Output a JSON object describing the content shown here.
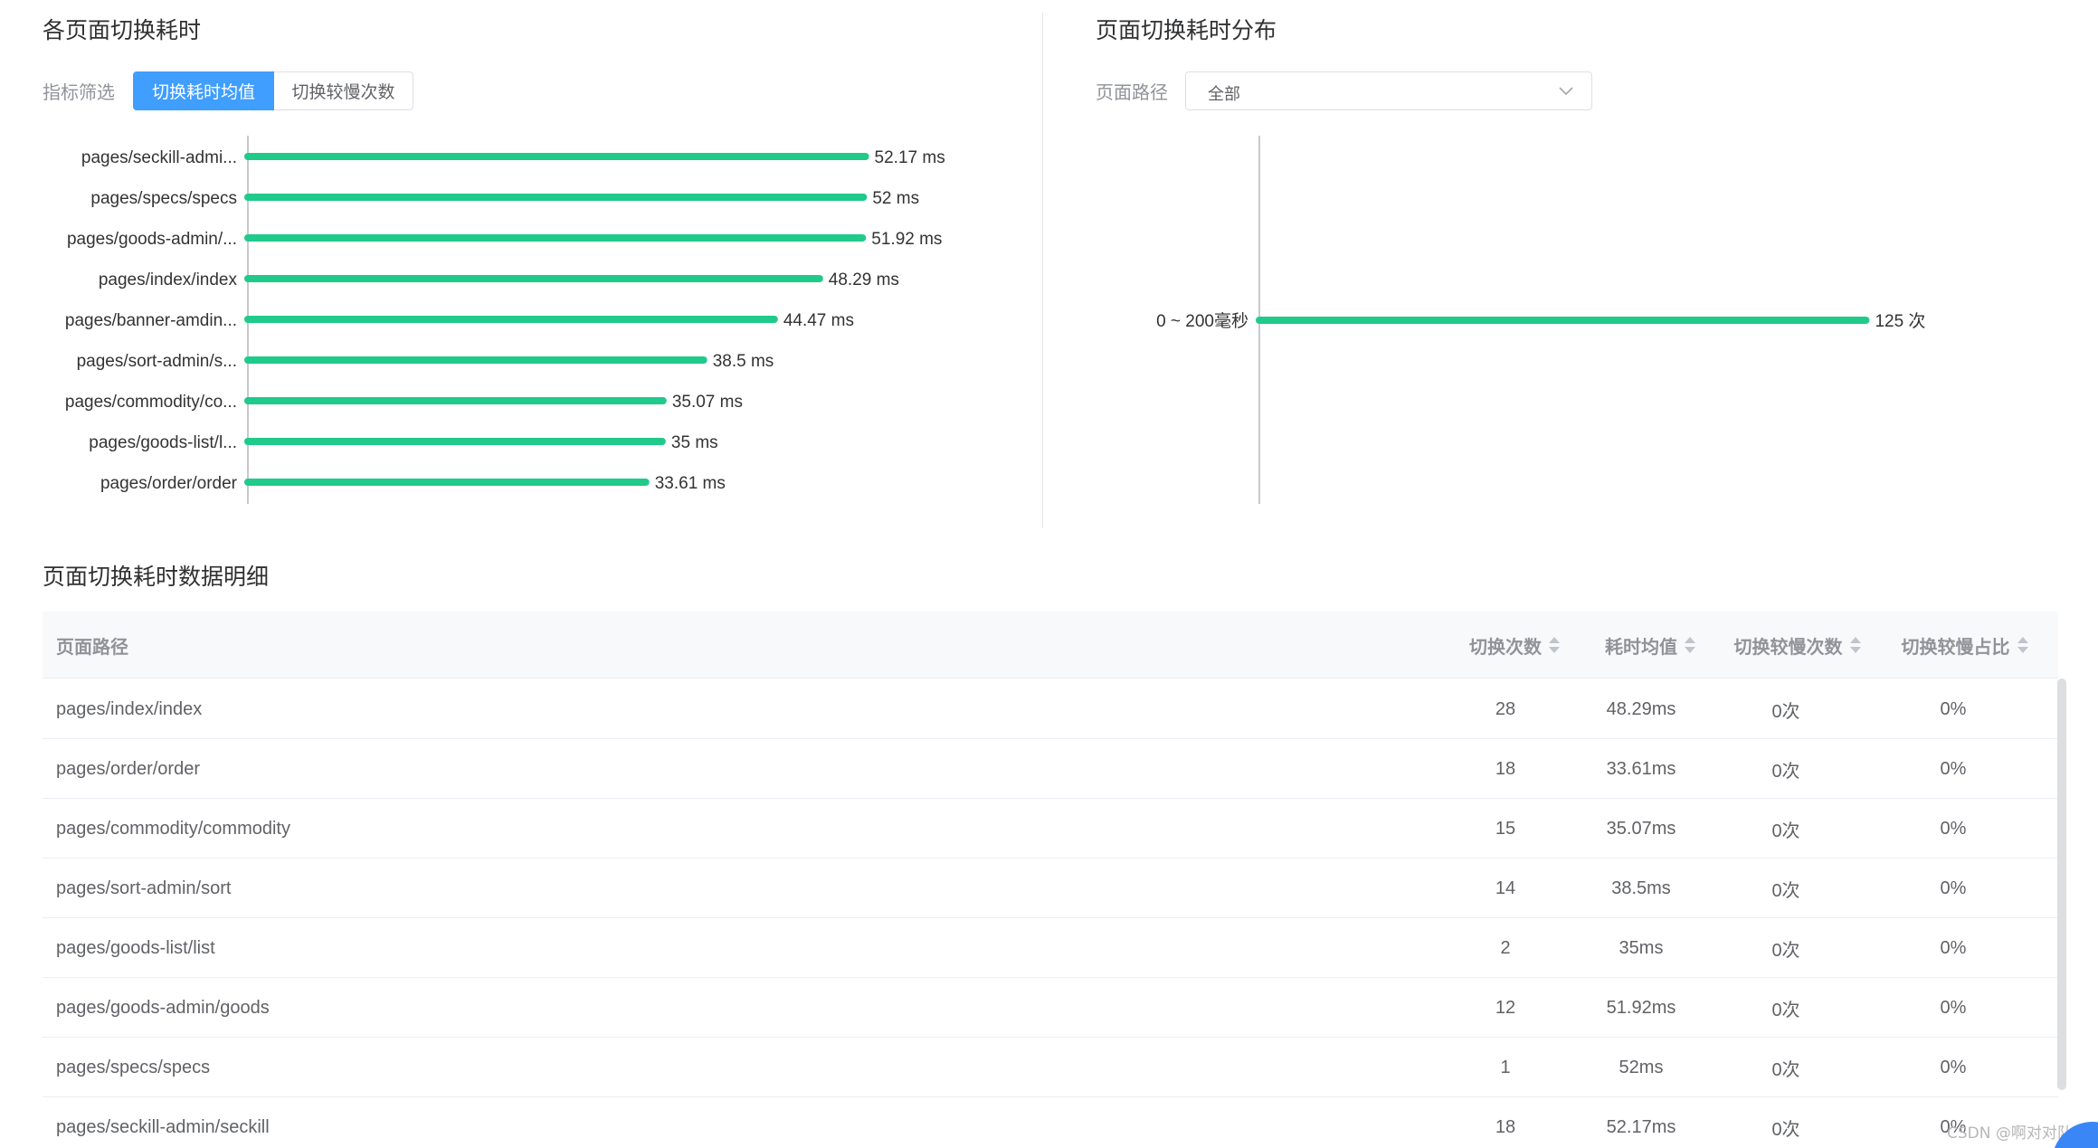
{
  "left_panel": {
    "title": "各页面切换耗时",
    "filter_label": "指标筛选",
    "tabs": [
      "切换耗时均值",
      "切换较慢次数"
    ],
    "active_tab": "切换耗时均值"
  },
  "right_panel": {
    "title": "页面切换耗时分布",
    "path_label": "页面路径",
    "select_value": "全部"
  },
  "colors": {
    "bar": "#1fca8a",
    "accent": "#409eff"
  },
  "chart_data": [
    {
      "type": "bar",
      "orientation": "horizontal",
      "categories": [
        "pages/seckill-admi...",
        "pages/specs/specs",
        "pages/goods-admin/...",
        "pages/index/index",
        "pages/banner-amdin...",
        "pages/sort-admin/s...",
        "pages/commodity/co...",
        "pages/goods-list/l...",
        "pages/order/order"
      ],
      "values": [
        52.17,
        52,
        51.92,
        48.29,
        44.47,
        38.5,
        35.07,
        35,
        33.61
      ],
      "labels": [
        "52.17 ms",
        "52 ms",
        "51.92 ms",
        "48.29 ms",
        "44.47 ms",
        "38.5 ms",
        "35.07 ms",
        "35 ms",
        "33.61 ms"
      ],
      "xlim": [
        0,
        60
      ]
    },
    {
      "type": "bar",
      "orientation": "horizontal",
      "categories": [
        "0 ~ 200毫秒"
      ],
      "values": [
        125
      ],
      "labels": [
        "125 次"
      ],
      "xlim": [
        0,
        165
      ]
    }
  ],
  "table": {
    "title": "页面切换耗时数据明细",
    "headers": [
      "页面路径",
      "切换次数",
      "耗时均值",
      "切换较慢次数",
      "切换较慢占比"
    ],
    "rows": [
      [
        "pages/index/index",
        "28",
        "48.29ms",
        "0次",
        "0%"
      ],
      [
        "pages/order/order",
        "18",
        "33.61ms",
        "0次",
        "0%"
      ],
      [
        "pages/commodity/commodity",
        "15",
        "35.07ms",
        "0次",
        "0%"
      ],
      [
        "pages/sort-admin/sort",
        "14",
        "38.5ms",
        "0次",
        "0%"
      ],
      [
        "pages/goods-list/list",
        "2",
        "35ms",
        "0次",
        "0%"
      ],
      [
        "pages/goods-admin/goods",
        "12",
        "51.92ms",
        "0次",
        "0%"
      ],
      [
        "pages/specs/specs",
        "1",
        "52ms",
        "0次",
        "0%"
      ],
      [
        "pages/seckill-admin/seckill",
        "18",
        "52.17ms",
        "0次",
        "0%"
      ]
    ]
  },
  "watermark": "CSDN @啊对对队。"
}
